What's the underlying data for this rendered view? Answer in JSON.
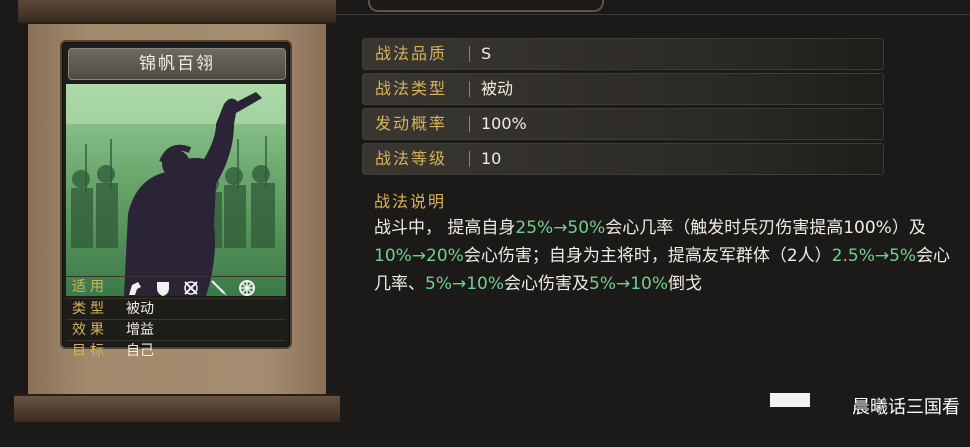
{
  "skill": {
    "name": "锦帆百翎",
    "attrs": {
      "applicable_label": "适用",
      "applicable_icons": [
        "cavalry-icon",
        "shield-icon",
        "crossed-bows-icon",
        "spear-icon",
        "wheel-icon"
      ],
      "type_label": "类型",
      "type_value": "被动",
      "effect_label": "效果",
      "effect_value": "增益",
      "target_label": "目标",
      "target_value": "自己"
    }
  },
  "info": {
    "quality_label": "战法品质",
    "quality_value": "S",
    "category_label": "战法类型",
    "category_value": "被动",
    "chance_label": "发动概率",
    "chance_value": "100%",
    "level_label": "战法等级",
    "level_value": "10"
  },
  "description": {
    "title": "战法说明",
    "segments": [
      {
        "t": "战斗中， 提高自身",
        "hl": false
      },
      {
        "t": "25%→50%",
        "hl": true
      },
      {
        "t": "会心几率（触发时兵刃伤害提高100%）及",
        "hl": false
      },
      {
        "t": "10%→20%",
        "hl": true
      },
      {
        "t": "会心伤害；自身为主将时，提高友军群体（2人）",
        "hl": false
      },
      {
        "t": "2.5%→5%",
        "hl": true
      },
      {
        "t": "会心几率、",
        "hl": false
      },
      {
        "t": "5%→10%",
        "hl": true
      },
      {
        "t": "会心伤害及",
        "hl": false
      },
      {
        "t": "5%→10%",
        "hl": true
      },
      {
        "t": "倒戈",
        "hl": false
      }
    ]
  },
  "watermark": "晨曦话三国看",
  "colors": {
    "gold_label": "#d7b25a",
    "highlight": "#6fd08f",
    "text": "#efebe3"
  }
}
